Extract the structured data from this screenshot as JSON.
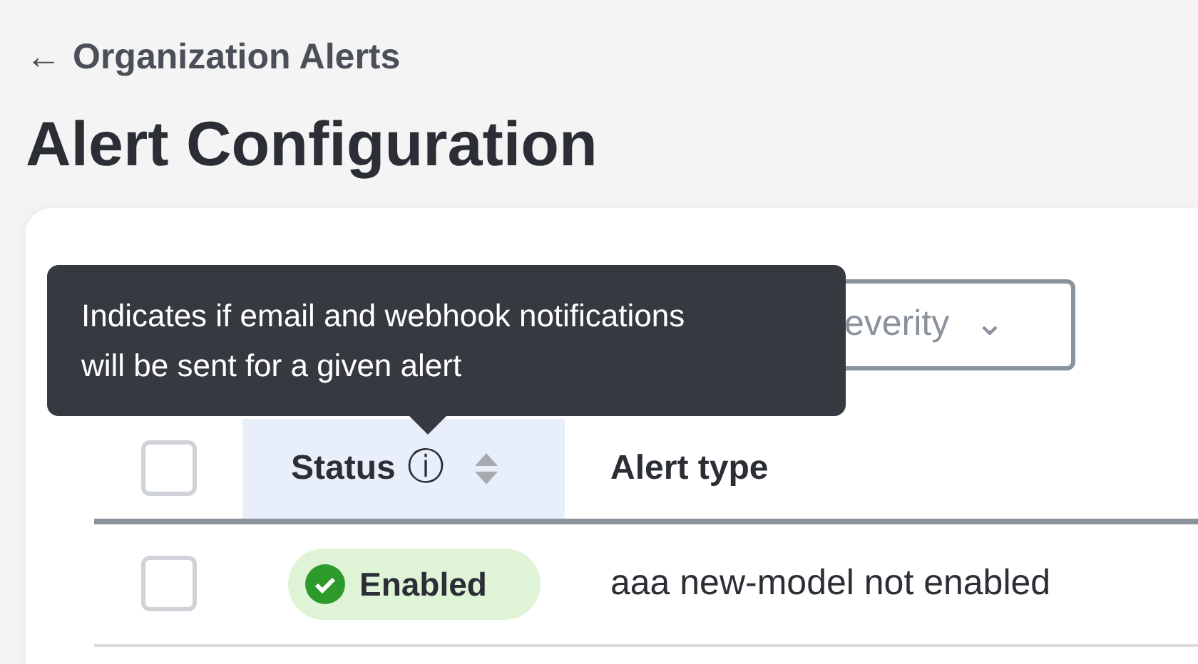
{
  "back_link": {
    "icon": "←",
    "label": "Organization Alerts"
  },
  "title": "Alert Configuration",
  "filters": [
    {
      "label": "everity",
      "caret": "⌄"
    }
  ],
  "tooltip": {
    "text": "Indicates if email and webhook notifications will be sent for a given alert"
  },
  "table": {
    "columns": [
      {
        "kind": "checkbox",
        "checked": false
      },
      {
        "kind": "status",
        "label": "Status",
        "info": "ⓘ",
        "sortable": true,
        "highlighted": true
      },
      {
        "kind": "text",
        "label": "Alert type",
        "highlighted": false
      }
    ],
    "rows": [
      {
        "checked": false,
        "status": "Enabled",
        "enabled": true,
        "alert_type": "aaa new-model not enabled"
      }
    ]
  }
}
